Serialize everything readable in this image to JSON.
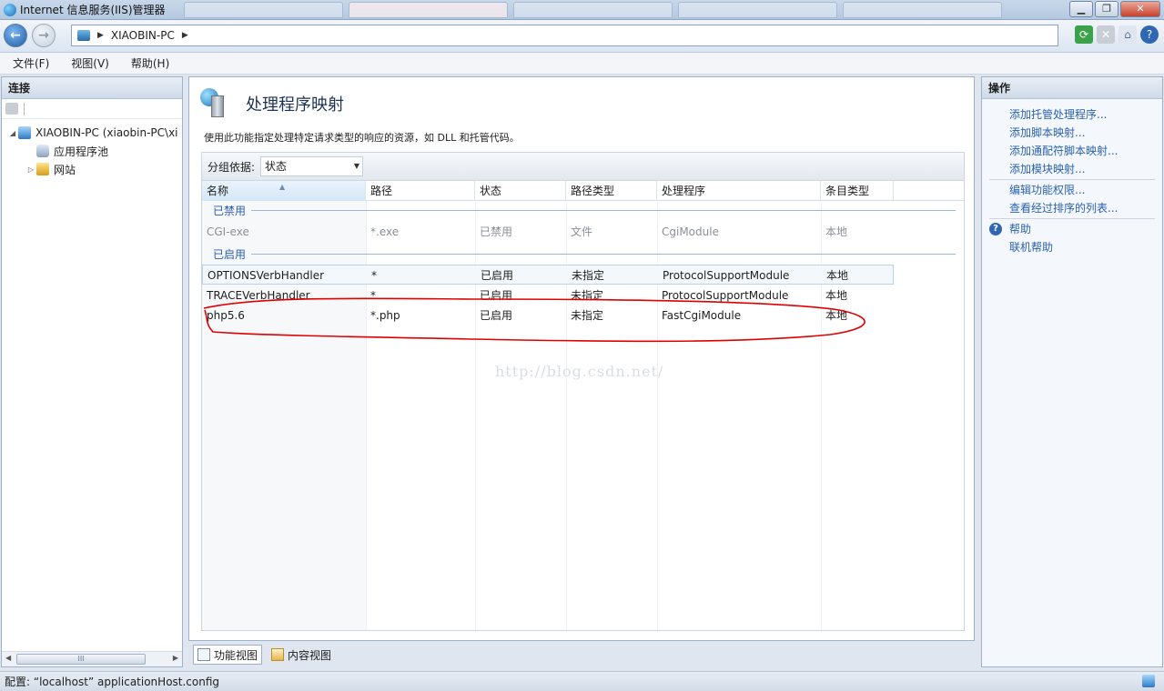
{
  "window": {
    "title": "Internet 信息服务(IIS)管理器"
  },
  "address": {
    "path": "XIAOBIN-PC"
  },
  "menu": [
    {
      "label": "文件(F)"
    },
    {
      "label": "视图(V)"
    },
    {
      "label": "帮助(H)"
    }
  ],
  "connections": {
    "header": "连接",
    "tree": [
      {
        "label": "XIAOBIN-PC (xiaobin-PC\\xi",
        "icon": "server-icon",
        "toggle": "◢"
      },
      {
        "label": "应用程序池",
        "icon": "app-pool-icon",
        "toggle": ""
      },
      {
        "label": "网站",
        "icon": "sites-icon",
        "toggle": "▷"
      }
    ],
    "scroll_thumb": "III"
  },
  "main": {
    "title": "处理程序映射",
    "description": "使用此功能指定处理特定请求类型的响应的资源，如 DLL 和托管代码。",
    "group_by_label": "分组依据:",
    "group_by_value": "状态",
    "columns": [
      "名称",
      "路径",
      "状态",
      "路径类型",
      "处理程序",
      "条目类型"
    ],
    "groups": {
      "disabled": "已禁用",
      "enabled": "已启用"
    },
    "disabled_rows": [
      [
        "CGI-exe",
        "*.exe",
        "已禁用",
        "文件",
        "CgiModule",
        "本地"
      ]
    ],
    "enabled_rows": [
      [
        "OPTIONSVerbHandler",
        "*",
        "已启用",
        "未指定",
        "ProtocolSupportModule",
        "本地"
      ],
      [
        "TRACEVerbHandler",
        "*",
        "已启用",
        "未指定",
        "ProtocolSupportModule",
        "本地"
      ],
      [
        "php5.6",
        "*.php",
        "已启用",
        "未指定",
        "FastCgiModule",
        "本地"
      ]
    ],
    "watermark": "http://blog.csdn.net/"
  },
  "view_tabs": [
    {
      "label": "功能视图"
    },
    {
      "label": "内容视图"
    }
  ],
  "actions": {
    "header": "操作",
    "group1": [
      "添加托管处理程序...",
      "添加脚本映射...",
      "添加通配符脚本映射...",
      "添加模块映射..."
    ],
    "group2": [
      "编辑功能权限...",
      "查看经过排序的列表..."
    ],
    "group3": [
      "帮助",
      "联机帮助"
    ]
  },
  "status": {
    "text": "配置: “localhost” applicationHost.config"
  },
  "colors": {
    "link": "#2b62b0",
    "annotation": "#e00000"
  }
}
